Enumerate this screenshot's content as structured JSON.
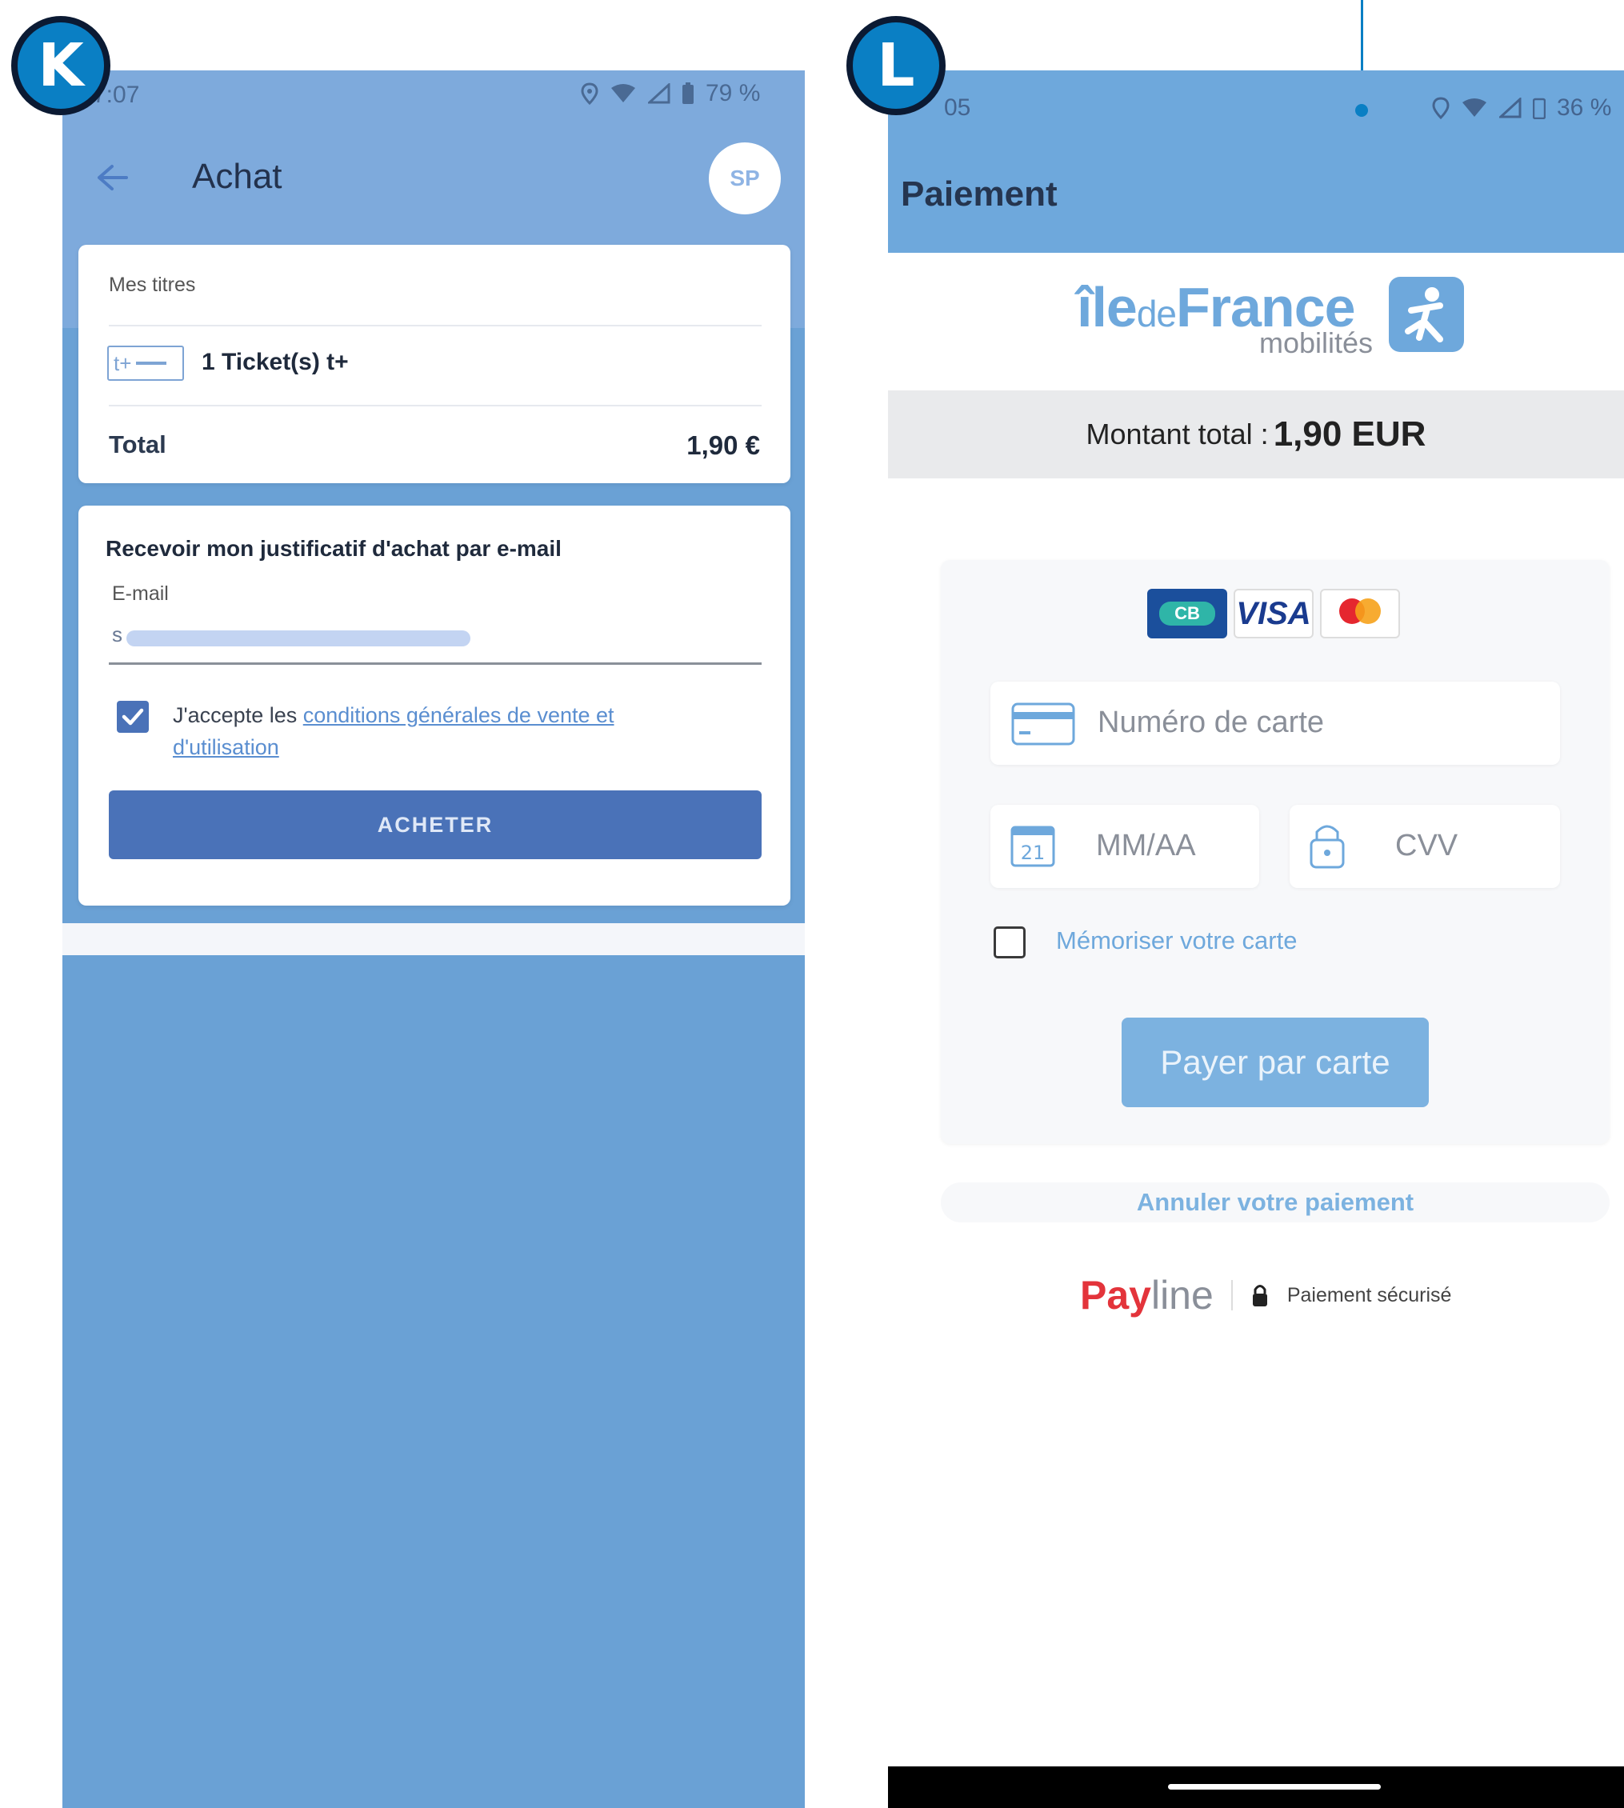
{
  "badges": {
    "left": "K",
    "right": "L"
  },
  "screen_k": {
    "status": {
      "time": "7:07",
      "battery": "79 %"
    },
    "header": {
      "title": "Achat",
      "avatar_initials": "SP"
    },
    "summary": {
      "section_label": "Mes titres",
      "ticket_icon_text": "t+",
      "ticket_label": "1 Ticket(s) t+",
      "total_label": "Total",
      "total_value": "1,90 €"
    },
    "receipt": {
      "heading": "Recevoir mon justificatif d'achat par e-mail",
      "email_label": "E-mail",
      "email_value": "s",
      "accept_prefix": "J'accepte les ",
      "accept_link_line1": "conditions générales de vente et",
      "accept_link_line2": "d'utilisation",
      "buy_button": "ACHETER"
    }
  },
  "screen_l": {
    "status": {
      "time": "05",
      "battery": "36 %"
    },
    "header": {
      "title": "Paiement"
    },
    "brand": {
      "main_ile": "île",
      "main_de": "de",
      "main_france": "France",
      "sub": "mobilités"
    },
    "total": {
      "label": "Montant total : ",
      "value": "1,90 EUR"
    },
    "card_logos": {
      "cb": "CB",
      "visa": "VISA"
    },
    "form": {
      "card_number_placeholder": "Numéro de carte",
      "expiry_placeholder": "MM/AA",
      "expiry_icon_text": "21",
      "cvv_placeholder": "CVV",
      "remember_label": "Mémoriser votre carte",
      "pay_button": "Payer par carte"
    },
    "cancel_link": "Annuler votre paiement",
    "footer": {
      "brand_pay": "Pay",
      "brand_line": "line",
      "secure_label": "Paiement sécurisé"
    }
  },
  "colors": {
    "primary_blue": "#4a72b8",
    "header_blue": "#6ea8dc",
    "link_blue": "#5a8ed0",
    "payline_red": "#e3343b"
  }
}
